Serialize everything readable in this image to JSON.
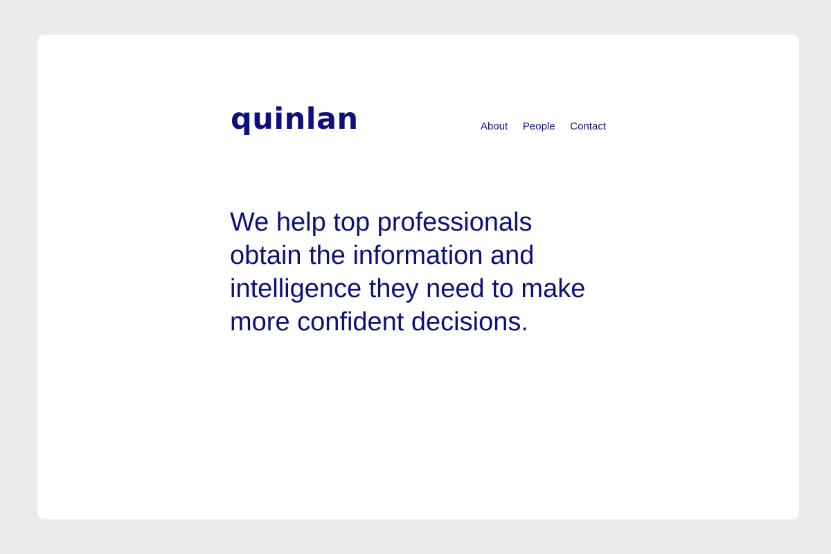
{
  "brand": {
    "name": "quinlan",
    "color": "#0d0f7a"
  },
  "nav": {
    "items": [
      {
        "label": "About"
      },
      {
        "label": "People"
      },
      {
        "label": "Contact"
      }
    ]
  },
  "hero": {
    "lines": [
      "We help top professionals",
      "obtain the information and",
      "intelligence they need to make",
      "more confident decisions."
    ]
  },
  "colors": {
    "background": "#ebebeb",
    "card": "#ffffff",
    "text": "#0d0f7a"
  }
}
